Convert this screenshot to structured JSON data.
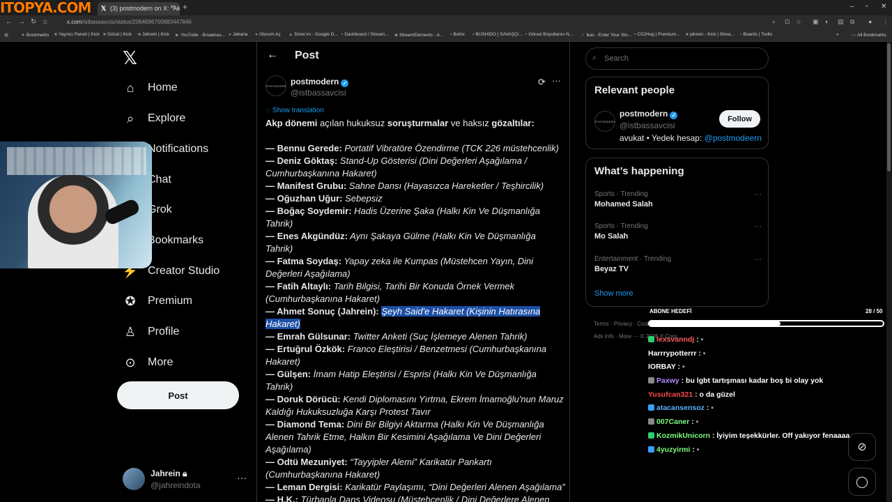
{
  "browser": {
    "watermark": "ITOPYA.COM",
    "tab_title": "(3) postmodern on X: \"Akp dönem",
    "url_prefix": "x.com",
    "url_path": "/istbassavcisi/status/2064696700883447846",
    "bookmarks": [
      "Bookmarks",
      "Yayıncı Paneli | Kick",
      "Gözat | Kick",
      "Jahrein | Kick",
      "YouTube - Broadcas...",
      "Jaharia",
      "Oturum Aç",
      "Drive'ım - Google D...",
      "Dashboard / Stream...",
      "StreamElements - A...",
      "Botrix",
      "BUSHIDO | SAVAŞÇI...",
      "Görsel Boyutlarını N...",
      "ikas - Enter Your Sto...",
      "CS2Hug | Premium...",
      "jahrein - Kick | Strea...",
      "Boards | Trello"
    ],
    "all_bookmarks": "All Bookmarks"
  },
  "sidebar": {
    "items": [
      {
        "label": "Home",
        "icon": "home-icon"
      },
      {
        "label": "Explore",
        "icon": "search-icon"
      },
      {
        "label": "Notifications",
        "icon": "bell-icon"
      },
      {
        "label": "Chat",
        "icon": "chat-icon"
      },
      {
        "label": "Grok",
        "icon": "grok-icon"
      },
      {
        "label": "Bookmarks",
        "icon": "bookmark-icon"
      },
      {
        "label": "Creator Studio",
        "icon": "creator-icon"
      },
      {
        "label": "Premium",
        "icon": "premium-icon"
      },
      {
        "label": "Profile",
        "icon": "profile-icon"
      },
      {
        "label": "More",
        "icon": "more-icon"
      }
    ],
    "post_button": "Post",
    "account_name": "Jahrein",
    "account_handle": "@jahreindota"
  },
  "post": {
    "header_title": "Post",
    "author_name": "postmodern",
    "author_handle": "@istbassavcisi",
    "avatar_text": "POSTMODERN",
    "show_translation": "Show translation",
    "intro_bold1": "Akp dönemi",
    "intro_text1": " açılan hukuksuz ",
    "intro_bold2": "soruşturmalar",
    "intro_text2": " ve haksız ",
    "intro_bold3": "gözaltılar:",
    "entries": [
      {
        "name": "— Bennu Gerede:",
        "text": " Portatif Vibratöre Özendirme (TCK 226 müstehcenlik)"
      },
      {
        "name": "— Deniz Göktaş:",
        "text": " Stand-Up Gösterisi (Dini Değerleri Aşağılama / Cumhurbaşkanına Hakaret)"
      },
      {
        "name": "— Manifest Grubu:",
        "text": " Sahne Dansı (Hayasızca Hareketler / Teşhircilik)"
      },
      {
        "name": "— Oğuzhan Uğur:",
        "text": " Sebepsiz"
      },
      {
        "name": "— Boğaç Soydemir:",
        "text": " Hadis Üzerine Şaka (Halkı Kin Ve Düşmanlığa Tahrik)"
      },
      {
        "name": "— Enes Akgündüz:",
        "text": " Aynı Şakaya Gülme (Halkı Kin Ve Düşmanlığa Tahrik)"
      },
      {
        "name": "— Fatma Soydaş:",
        "text": " Yapay zeka ile Kumpas (Müstehcen Yayın, Dini Değerleri Aşağılama)"
      },
      {
        "name": "— Fatih Altaylı:",
        "text": " Tarih Bilgisi, Tarihi Bir Konuda Örnek Vermek (Cumhurbaşkanına Hakaret)"
      },
      {
        "name": "— Ahmet Sonuç (Jahrein):",
        "text": " ",
        "highlight": "Şeyh Said'e Hakaret (Kişinin Hatırasına Hakaret)"
      },
      {
        "name": "— Emrah Gülsunar:",
        "text": " Twitter Anketi (Suç İşlemeye Alenen Tahrik)"
      },
      {
        "name": "— Ertuğrul Özkök:",
        "text": " Franco Eleştirisi / Benzetmesi (Cumhurbaşkanına Hakaret)"
      },
      {
        "name": "— Gülşen:",
        "text": " İmam Hatip Eleştirisi / Esprisi (Halkı Kin Ve Düşmanlığa Tahrik)"
      },
      {
        "name": "— Doruk Dörücü:",
        "text": " Kendi Diplomasını Yırtma, Ekrem İmamoğlu'nun Maruz Kaldığı Hukuksuzluğa Karşı Protest Tavır"
      },
      {
        "name": "— Diamond Tema:",
        "text": " Dini Bir Bilgiyi Aktarma (Halkı Kin Ve Düşmanlığa Alenen Tahrik Etme, Halkın Bir Kesimini Aşağılama Ve Dini Değerleri Aşağılama)"
      },
      {
        "name": "— Odtü Mezuniyet:",
        "text": " “Tayyipler Alemi” Karikatür Pankartı (Cumhurbaşkanına Hakaret)"
      },
      {
        "name": "— Leman Dergisi:",
        "text": " Karikatür Paylaşımı, “Dini Değerleri Alenen Aşağılama”"
      },
      {
        "name": "— H.K.:",
        "text": " Türbanla Dans Videosu (Müstehcenlik / Dini Değerlere Alenen"
      }
    ]
  },
  "right": {
    "search_placeholder": "Search",
    "relevant_title": "Relevant people",
    "rp_name": "postmodern",
    "rp_handle": "@istbassavcisi",
    "rp_bio": "avukat • Yedek hesap: ",
    "rp_bio_link": "@postmodeern",
    "follow": "Follow",
    "happening_title": "What’s happening",
    "trends": [
      {
        "meta": "Sports · Trending",
        "name": "Mohamed Salah"
      },
      {
        "meta": "Sports · Trending",
        "name": "Mo Salah"
      },
      {
        "meta": "Entertainment · Trending",
        "name": "Beyaz TV"
      }
    ],
    "show_more": "Show more",
    "footer_line1": "Terms  ·  Privacy  ·  Cookies  ·  Accessibility  ·",
    "footer_line2": "Ads info  ·  More ···  © 2026 X Corp."
  },
  "overlay": {
    "goal_label": "ABONE HEDEFİ",
    "goal_count": "28 / 50",
    "goal_fraction": 0.56,
    "chat": [
      {
        "user": "lexsvanndj",
        "color": "#ff5a5a",
        "msg": " : ",
        "emote": "▪",
        "badge": "#2ecc71"
      },
      {
        "user": "Harrrypotterrr",
        "color": "#ffffff",
        "msg": " : ",
        "emote": "▪",
        "badge": ""
      },
      {
        "user": "IORBAY",
        "color": "#ffffff",
        "msg": " : ",
        "emote": "▪",
        "badge": ""
      },
      {
        "user": "Paxwy",
        "color": "#b48cff",
        "msg": " : bu lgbt tartışması kadar boş bi olay yok",
        "emote": "",
        "badge": "#888888"
      },
      {
        "user": "Yusufcan321",
        "color": "#ff4a4a",
        "msg": " : o da güzel",
        "emote": "",
        "badge": ""
      },
      {
        "user": "atacansensoz",
        "color": "#5ab0ff",
        "msg": " : ",
        "emote": "▪",
        "badge": "#3aa0ff"
      },
      {
        "user": "007Caner",
        "color": "#7dff7d",
        "msg": " : ",
        "emote": "▪",
        "badge": "#888888"
      },
      {
        "user": "KozmikUnicorn",
        "color": "#7dff7d",
        "msg": " : İyiyim teşekkürler. Off yakıyor fenaaaa",
        "emote": "",
        "badge": "#2ecc71"
      },
      {
        "user": "4yuzyirmi",
        "color": "#7dff7d",
        "msg": " : ",
        "emote": "▪",
        "badge": "#3aa0ff"
      }
    ]
  }
}
